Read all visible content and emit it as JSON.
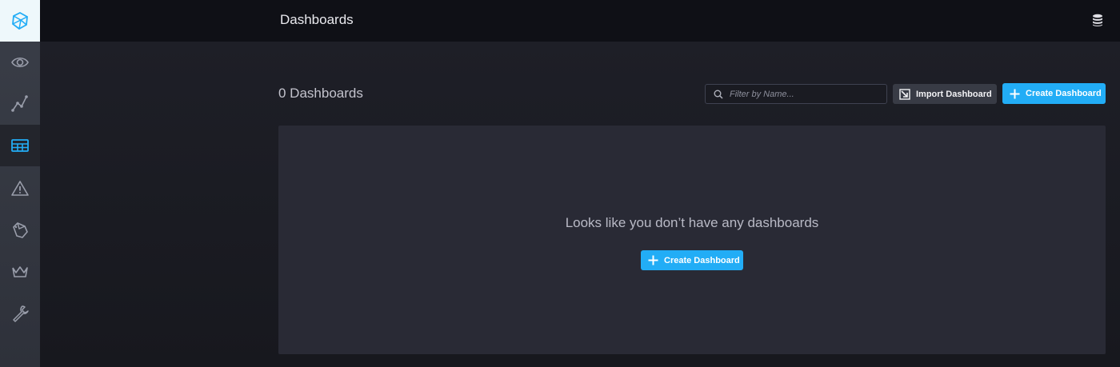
{
  "header": {
    "title": "Dashboards"
  },
  "sidebar": {
    "items": [
      {
        "icon": "eye-icon",
        "active": false
      },
      {
        "icon": "graph-icon",
        "active": false
      },
      {
        "icon": "dashboard-icon",
        "active": true
      },
      {
        "icon": "alert-icon",
        "active": false
      },
      {
        "icon": "tag-icon",
        "active": false
      },
      {
        "icon": "crown-icon",
        "active": false
      },
      {
        "icon": "wrench-icon",
        "active": false
      }
    ]
  },
  "main": {
    "count_title": "0 Dashboards",
    "search": {
      "placeholder": "Filter by Name...",
      "value": ""
    },
    "import_label": "Import Dashboard",
    "create_label": "Create Dashboard",
    "empty_message": "Looks like you don’t have any dashboards",
    "empty_create_label": "Create Dashboard"
  },
  "colors": {
    "accent": "#22adf6",
    "header_bg": "#0f1016",
    "panel_bg": "#292a35",
    "sidebar_bg": "#3a3e48"
  }
}
